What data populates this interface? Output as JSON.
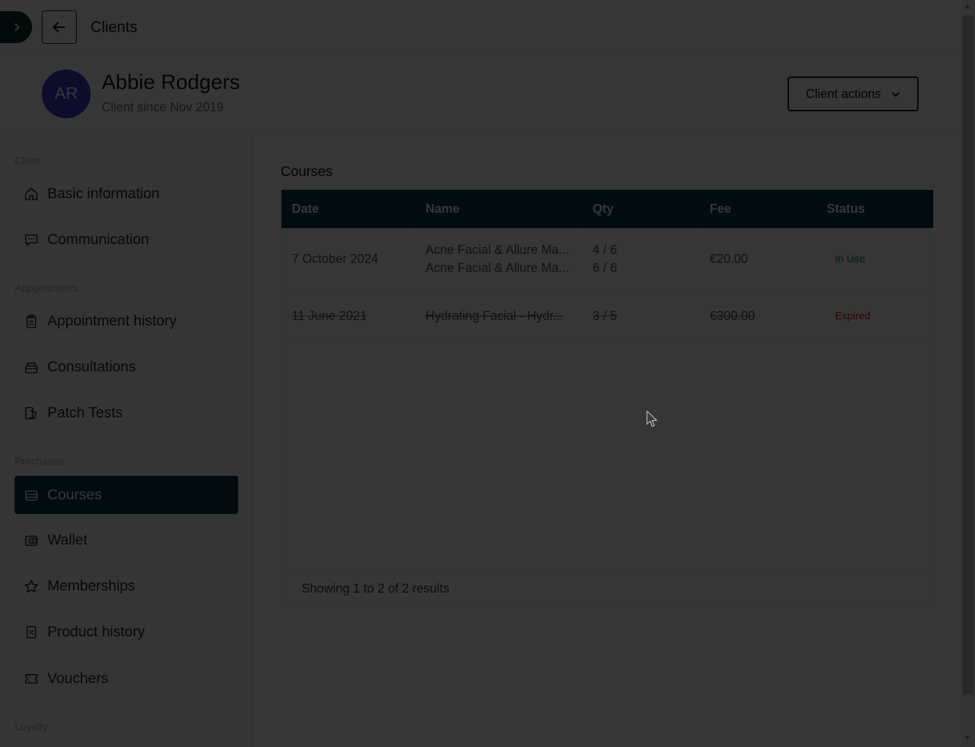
{
  "topbar": {
    "title": "Clients"
  },
  "client": {
    "initials": "AR",
    "name": "Abbie Rodgers",
    "since": "Client since Nov 2019",
    "actions_label": "Client actions"
  },
  "sidebar": {
    "sections": [
      {
        "label": "Client",
        "items": [
          "Basic information",
          "Communication"
        ]
      },
      {
        "label": "Appointments",
        "items": [
          "Appointment history",
          "Consultations",
          "Patch Tests"
        ]
      },
      {
        "label": "Purchases",
        "items": [
          "Courses",
          "Wallet",
          "Memberships",
          "Product history",
          "Vouchers"
        ]
      },
      {
        "label": "Loyalty",
        "items": []
      }
    ],
    "active_item": "Courses"
  },
  "courses": {
    "title": "Courses",
    "columns": [
      "Date",
      "Name",
      "Qty",
      "Fee",
      "Status"
    ],
    "rows": [
      {
        "date": "7 October 2024",
        "names": [
          "Acne Facial & Allure Ma...",
          "Acne Facial & Allure Ma..."
        ],
        "qty": [
          "4 / 6",
          "6 / 6"
        ],
        "fee": "€20.00",
        "status": "In Use"
      },
      {
        "date": "11 June 2021",
        "names": [
          "Hydrating Facial - Hydr..."
        ],
        "qty": [
          "3 / 5"
        ],
        "fee": "€300.00",
        "status": "Expired"
      }
    ],
    "footer": "Showing 1 to 2 of 2 results"
  },
  "icons": {
    "expand": "chevron-right-icon",
    "back": "arrow-left-icon",
    "actions": "chevron-down-icon",
    "basic_information": "home-icon",
    "communication": "chat-icon",
    "appointment_history": "clipboard-icon",
    "consultations": "folder-icon",
    "patch_tests": "flask-icon",
    "courses": "stack-icon",
    "wallet": "wallet-icon",
    "memberships": "star-icon",
    "product_history": "receipt-icon",
    "vouchers": "ticket-icon"
  },
  "colors": {
    "primary": "#0e3a44",
    "avatar": "#4338ca",
    "in_use": "#15803d",
    "expired": "#b91c1c"
  }
}
